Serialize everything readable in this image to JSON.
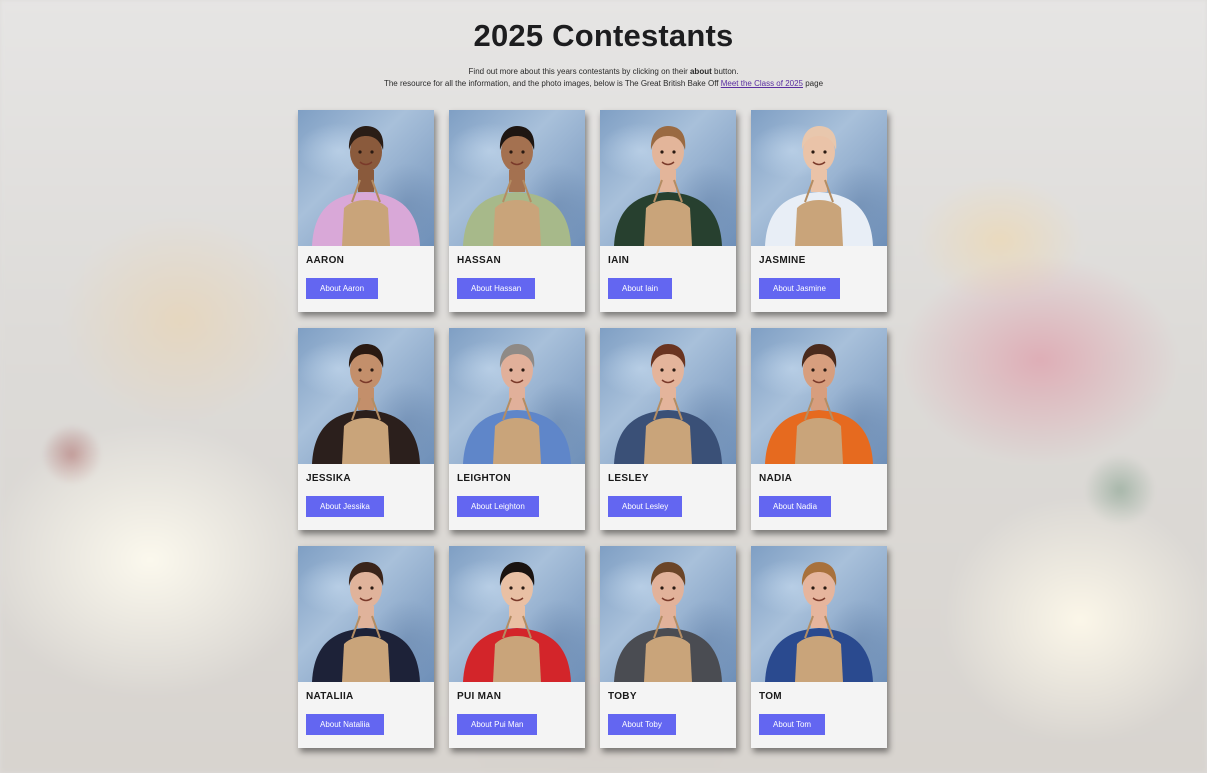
{
  "page": {
    "title": "2025 Contestants",
    "intro_line1_pre": "Find out more about this years contestants by clicking on their ",
    "intro_line1_bold": "about",
    "intro_line1_post": " button.",
    "intro_line2_pre": "The resource for all the information, and the photo images, below is The Great British Bake Off ",
    "intro_line2_link": "Meet the Class of 2025",
    "intro_line2_post": " page"
  },
  "contestants": [
    {
      "name": "AARON",
      "button": "About Aaron",
      "top": "#d9a8d8",
      "skin": "#8a5a3c",
      "hair": "#2a1d16"
    },
    {
      "name": "HASSAN",
      "button": "About Hassan",
      "top": "#a7b98a",
      "skin": "#a47150",
      "hair": "#1e1612"
    },
    {
      "name": "IAIN",
      "button": "About Iain",
      "top": "#27402f",
      "skin": "#e3b59a",
      "hair": "#9a6a42"
    },
    {
      "name": "JASMINE",
      "button": "About Jasmine",
      "top": "#e8eef6",
      "skin": "#eac3a8",
      "hair": "#e8c7ad"
    },
    {
      "name": "JESSIKA",
      "button": "About Jessika",
      "top": "#2b1f1c",
      "skin": "#c38f6b",
      "hair": "#2a1a12"
    },
    {
      "name": "LEIGHTON",
      "button": "About Leighton",
      "top": "#5f86c9",
      "skin": "#e1b09a",
      "hair": "#8f8a86"
    },
    {
      "name": "LESLEY",
      "button": "About Lesley",
      "top": "#3a5077",
      "skin": "#e4b49b",
      "hair": "#6a3420"
    },
    {
      "name": "NADIA",
      "button": "About Nadia",
      "top": "#e66a1f",
      "skin": "#d79e7e",
      "hair": "#4a2a1c"
    },
    {
      "name": "NATALIIA",
      "button": "About Nataliia",
      "top": "#1d2238",
      "skin": "#e0b39b",
      "hair": "#3a241a"
    },
    {
      "name": "PUI MAN",
      "button": "About Pui Man",
      "top": "#d3252a",
      "skin": "#e9c0a4",
      "hair": "#1a1310"
    },
    {
      "name": "TOBY",
      "button": "About Toby",
      "top": "#4a4c52",
      "skin": "#e2b29a",
      "hair": "#6b4528"
    },
    {
      "name": "TOM",
      "button": "About Tom",
      "top": "#2a4a8f",
      "skin": "#e6b59d",
      "hair": "#a8713c"
    }
  ]
}
